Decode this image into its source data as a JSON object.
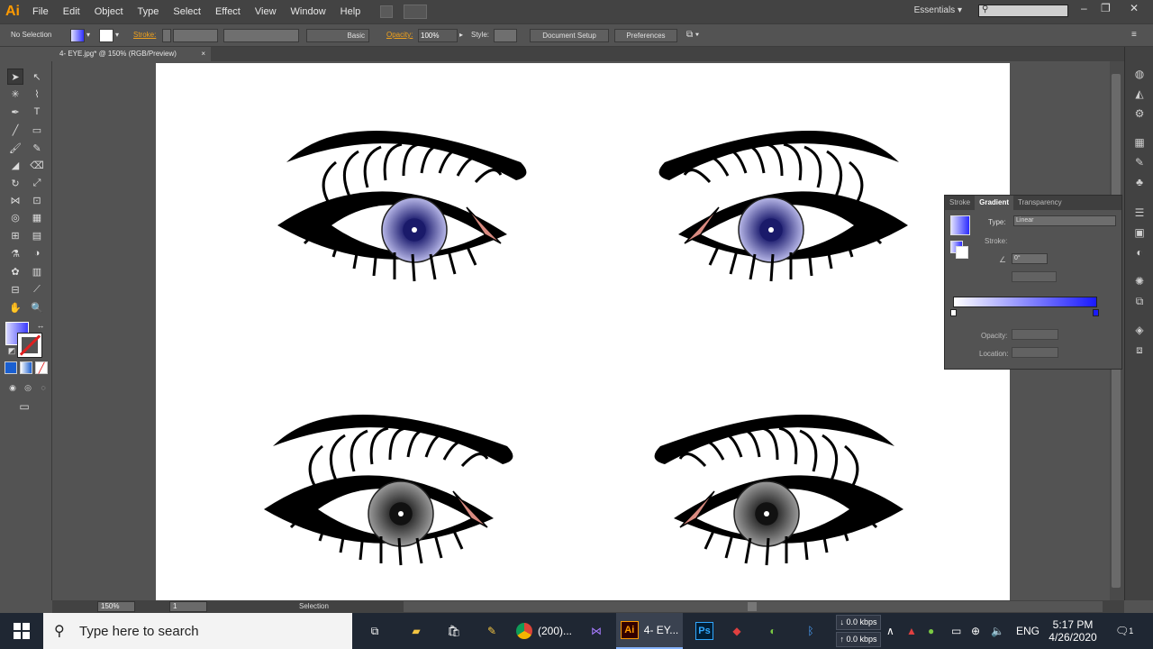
{
  "app": {
    "logo": "Ai"
  },
  "menubar": {
    "items": [
      "File",
      "Edit",
      "Object",
      "Type",
      "Select",
      "Effect",
      "View",
      "Window",
      "Help"
    ],
    "workspace": "Essentials",
    "window_controls": [
      "–",
      "❐",
      "✕"
    ]
  },
  "controlbar": {
    "selection": "No Selection",
    "stroke_label": "Stroke:",
    "brush": "Basic",
    "opacity_label": "Opacity:",
    "opacity_value": "100%",
    "style_label": "Style:",
    "document_setup": "Document Setup",
    "preferences": "Preferences"
  },
  "document": {
    "tab_title": "4- EYE.jpg* @ 150% (RGB/Preview)",
    "tab_close": "×"
  },
  "gradient_panel": {
    "tabs": [
      "Stroke",
      "Gradient",
      "Transparency"
    ],
    "type_label": "Type:",
    "type_value": "Linear",
    "stroke_label": "Stroke:",
    "angle_value": "0°",
    "opacity_label": "Opacity:",
    "location_label": "Location:",
    "gradient_start": "#ffffff",
    "gradient_end": "#1a1aff"
  },
  "statusbar": {
    "zoom": "150%",
    "artboard": "1",
    "tool_name": "Selection"
  },
  "taskbar": {
    "search_placeholder": "Type here to search",
    "chrome_label": "(200)...",
    "ai_label": "4- EY...",
    "net_down": "0.0 kbps",
    "net_up": "0.0 kbps",
    "language": "ENG",
    "time": "5:17 PM",
    "date": "4/26/2020",
    "notif_count": "1"
  },
  "colors": {
    "iris_blue": "#3a3a8c",
    "iris_gray": "#555555",
    "caruncle": "#d98a80"
  }
}
